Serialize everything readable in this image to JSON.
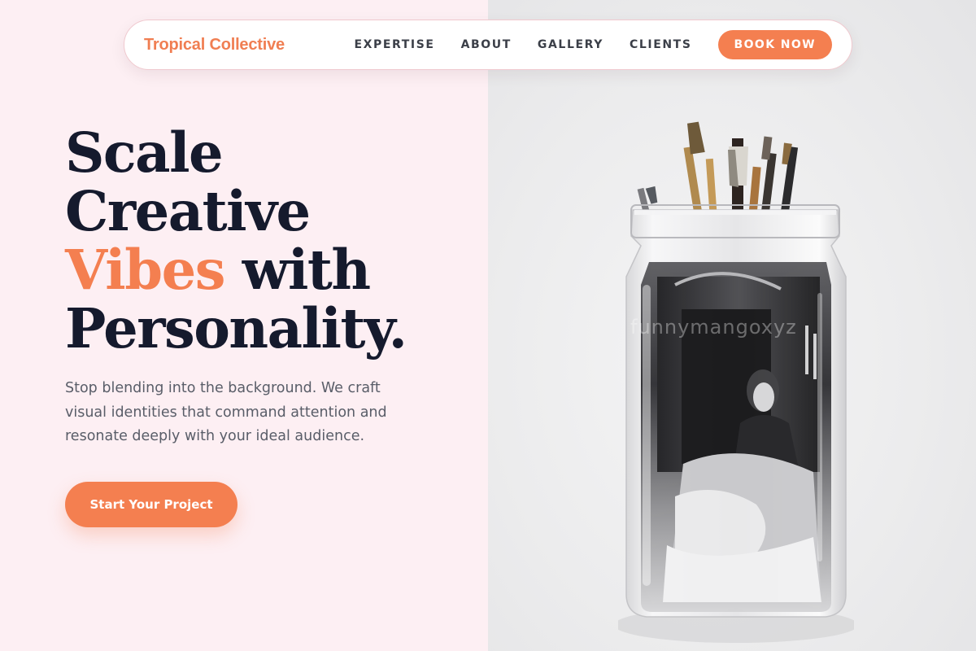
{
  "brand": {
    "name": "Tropical Collective"
  },
  "nav": {
    "links": [
      "EXPERTISE",
      "ABOUT",
      "GALLERY",
      "CLIENTS"
    ],
    "cta_label": "BOOK NOW"
  },
  "hero": {
    "title_line1": "Scale",
    "title_line2": "Creative",
    "title_accent": "Vibes",
    "title_line3_rest": " with",
    "title_line4": "Personality.",
    "subtitle": "Stop blending into the background. We craft visual identities that command attention and resonate deeply with your ideal audience.",
    "cta_label": "Start Your Project"
  },
  "image": {
    "watermark": "funnymangoxyz",
    "subject": "glass jar with paintbrushes containing a black-and-white photo"
  },
  "colors": {
    "accent": "#f47f50",
    "heading": "#151a2d",
    "body_text": "#595d68",
    "left_bg": "#fdeff3",
    "right_bg": "#ececed"
  }
}
